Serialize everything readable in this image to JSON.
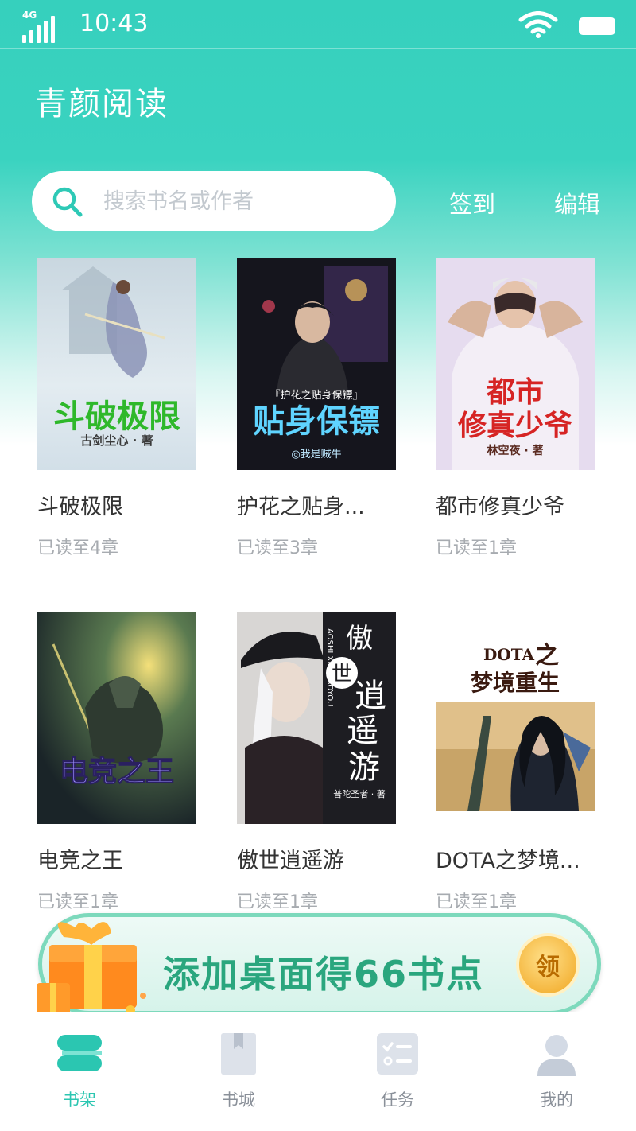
{
  "status_bar": {
    "network": "4G",
    "time": "10:43"
  },
  "header": {
    "title": "青颜阅读",
    "search_placeholder": "搜索书名或作者",
    "checkin_label": "签到",
    "edit_label": "编辑"
  },
  "books": [
    {
      "title": "斗破极限",
      "progress": "已读至4章",
      "cover_title": "斗破极限",
      "cover_author": "古剑尘心 · 著",
      "cover_bg": "#d8e4ec",
      "cover_title_color": "#2eb82a"
    },
    {
      "title": "护花之贴身...",
      "progress": "已读至3章",
      "cover_title": "贴身保镖",
      "cover_subtitle": "『护花之贴身保镖』",
      "cover_author": "◎我是贼牛",
      "cover_bg": "#15151d",
      "cover_title_color": "#5fd4ff"
    },
    {
      "title": "都市修真少爷",
      "progress": "已读至1章",
      "cover_title": "都市修真少爷",
      "cover_author": "林空夜 · 著",
      "cover_bg": "#e6dcef",
      "cover_title_color": "#d62424"
    },
    {
      "title": "电竞之王",
      "progress": "已读至1章",
      "cover_title": "电竞之王",
      "cover_bg": "#27343a",
      "cover_title_color": "#9b8cff"
    },
    {
      "title": "傲世逍遥游",
      "progress": "已读至1章",
      "cover_title": "傲世逍遥游",
      "cover_pinyin": "AOSHI XIAOYAOYOU",
      "cover_author": "普陀圣者 · 著",
      "cover_bg": "#1d1d22",
      "cover_title_color": "#ffffff"
    },
    {
      "title": "DOTA之梦境...",
      "progress": "已读至1章",
      "cover_title": "DOTA之梦境重生",
      "cover_bg": "#ffffff",
      "cover_title_color": "#3a1a10"
    }
  ],
  "banner": {
    "text": "添加桌面得66书点",
    "button_label": "领"
  },
  "bottom_nav": [
    {
      "label": "书架",
      "icon": "bookshelf-icon",
      "active": true
    },
    {
      "label": "书城",
      "icon": "bookstore-icon",
      "active": false
    },
    {
      "label": "任务",
      "icon": "tasks-icon",
      "active": false
    },
    {
      "label": "我的",
      "icon": "profile-icon",
      "active": false
    }
  ],
  "colors": {
    "accent": "#36d0bd",
    "active_tab": "#2bc6b1",
    "banner_text": "#2aa67e"
  }
}
